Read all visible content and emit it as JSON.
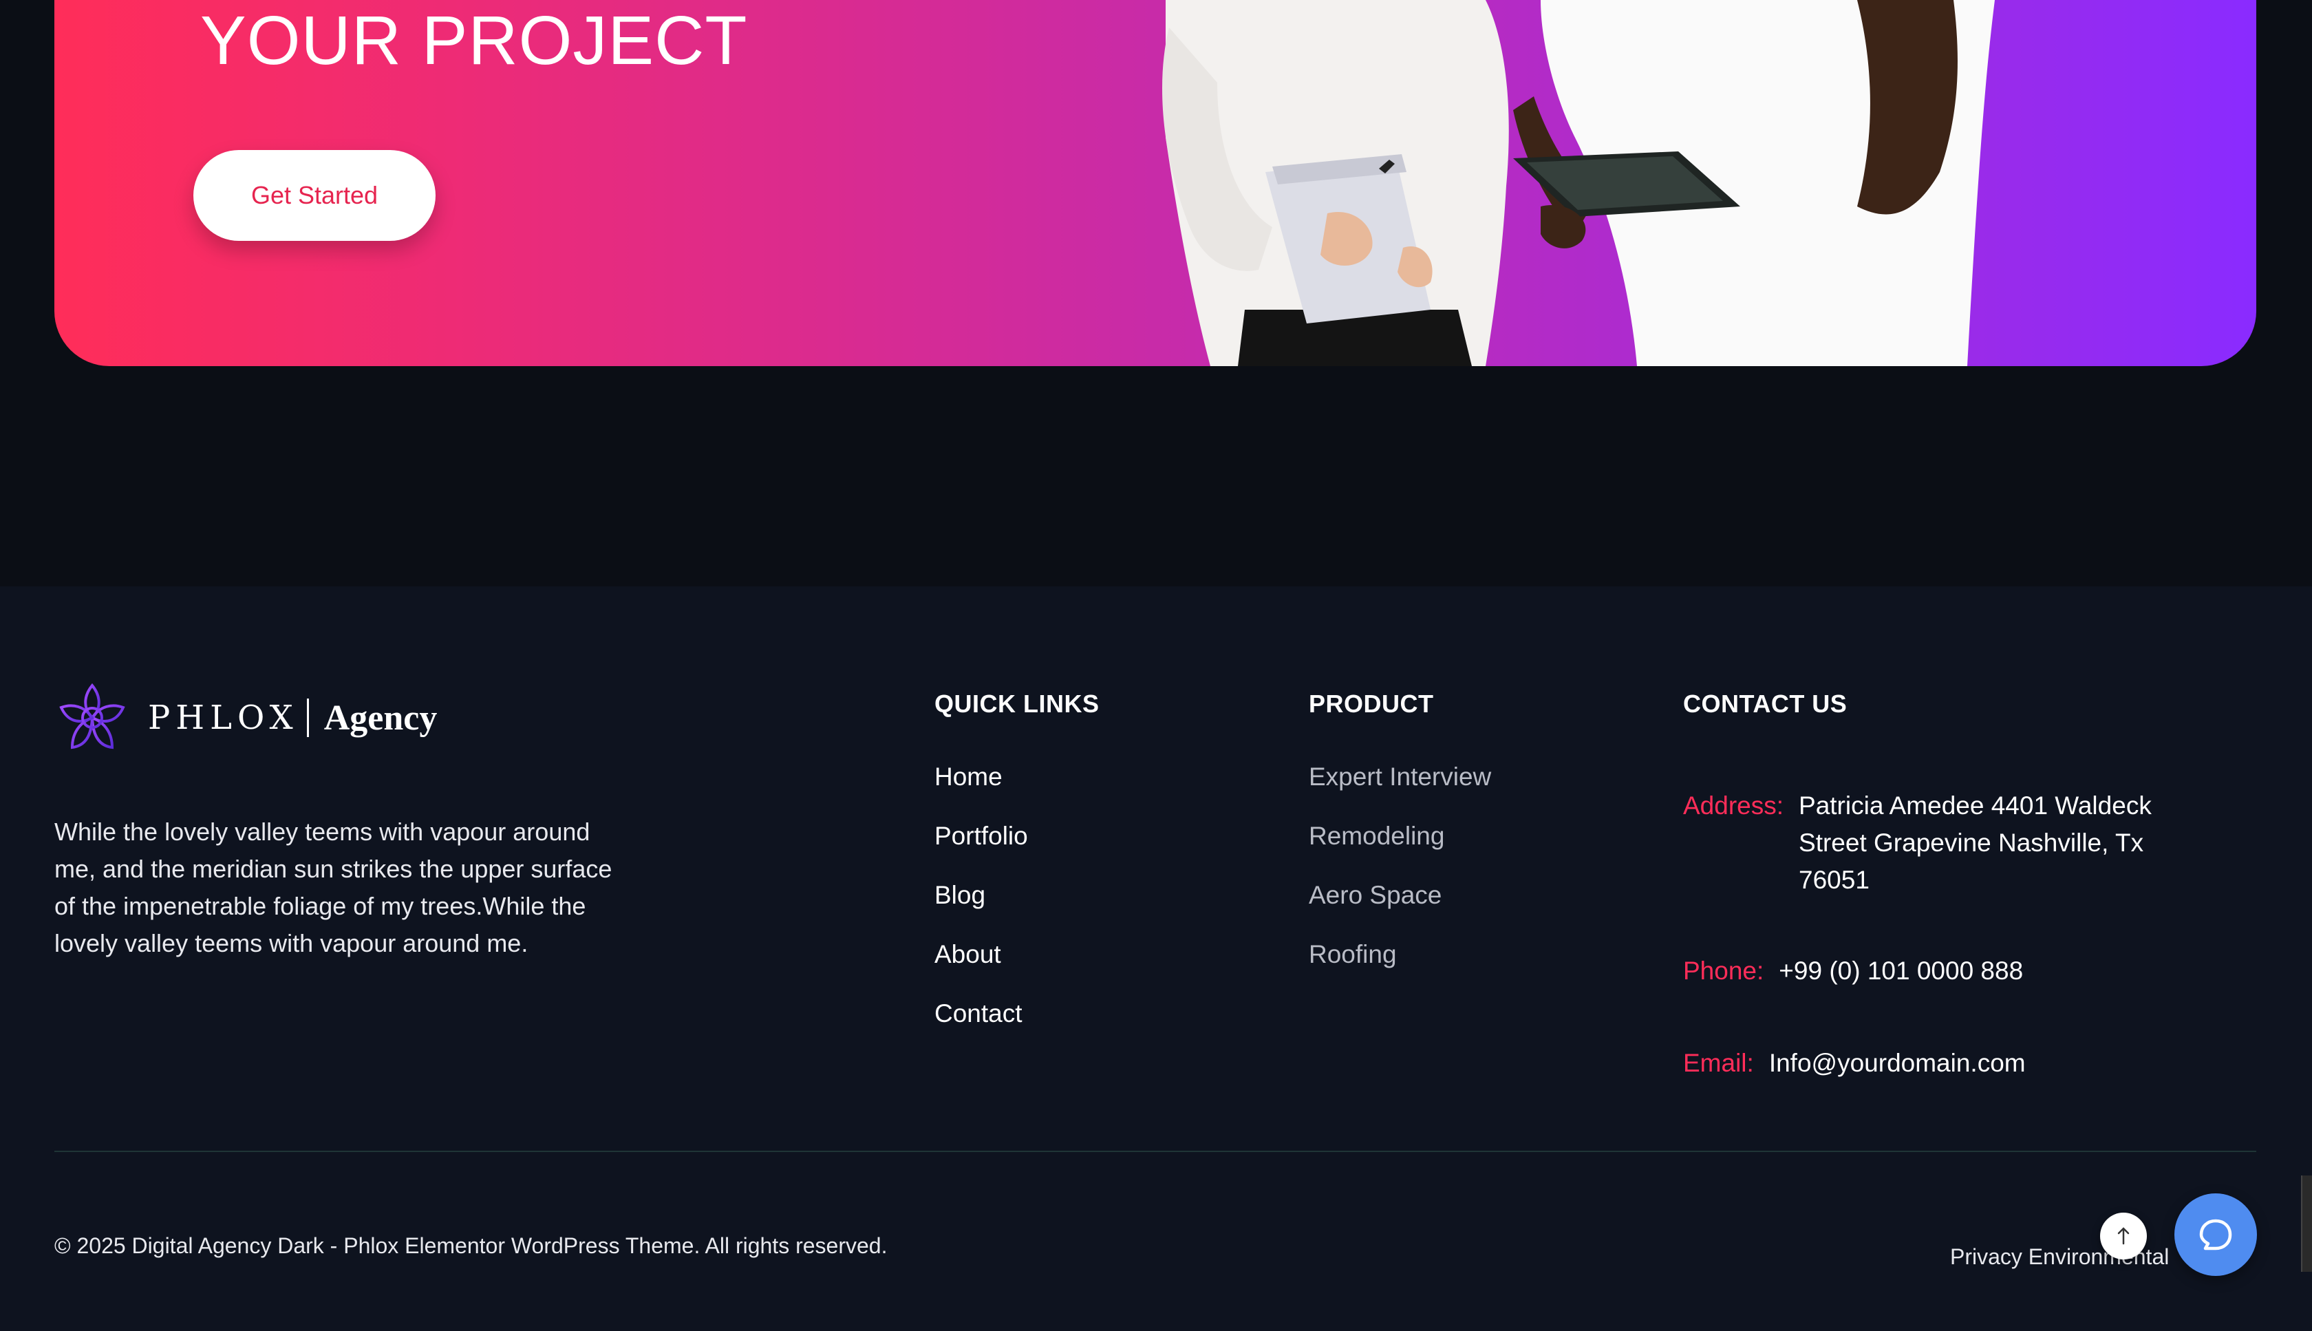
{
  "cta": {
    "title": "YOUR PROJECT",
    "button_label": "Get Started"
  },
  "footer": {
    "logo": {
      "word": "PHLOX",
      "agency": "Agency"
    },
    "about_text": "While the lovely valley teems with vapour around me, and the meridian sun strikes the upper surface of the impenetrable foliage of my trees.While the lovely valley teems with vapour around me.",
    "quick_links": {
      "heading": "QUICK LINKS",
      "items": [
        "Home",
        "Portfolio",
        "Blog",
        "About",
        "Contact"
      ]
    },
    "product": {
      "heading": "PRODUCT",
      "items": [
        "Expert Interview",
        "Remodeling",
        "Aero Space",
        "Roofing"
      ]
    },
    "contact": {
      "heading": "CONTACT US",
      "address_label": "Address:",
      "address_value": "Patricia Amedee 4401 Waldeck Street Grapevine Nashville, Tx 76051",
      "phone_label": "Phone:",
      "phone_value": "+99 (0) 101 0000 888",
      "email_label": "Email:",
      "email_value": "Info@yourdomain.com"
    },
    "copyright": "© 2025 Digital Agency Dark - Phlox Elementor WordPress Theme. All rights reserved.",
    "bottom_links": {
      "privacy": "Privacy",
      "environmental": "Environmental"
    }
  },
  "icons": {
    "logo": "lotus-logo-icon",
    "scroll_top": "arrow-up-icon",
    "chat": "chat-bubble-icon"
  },
  "colors": {
    "background": "#0b0e15",
    "footer_background": "#0e131f",
    "gradient_start": "#ff2d59",
    "gradient_end": "#8a2bff",
    "accent_red": "#ff2d59",
    "chat_blue": "#4f8cf0"
  }
}
